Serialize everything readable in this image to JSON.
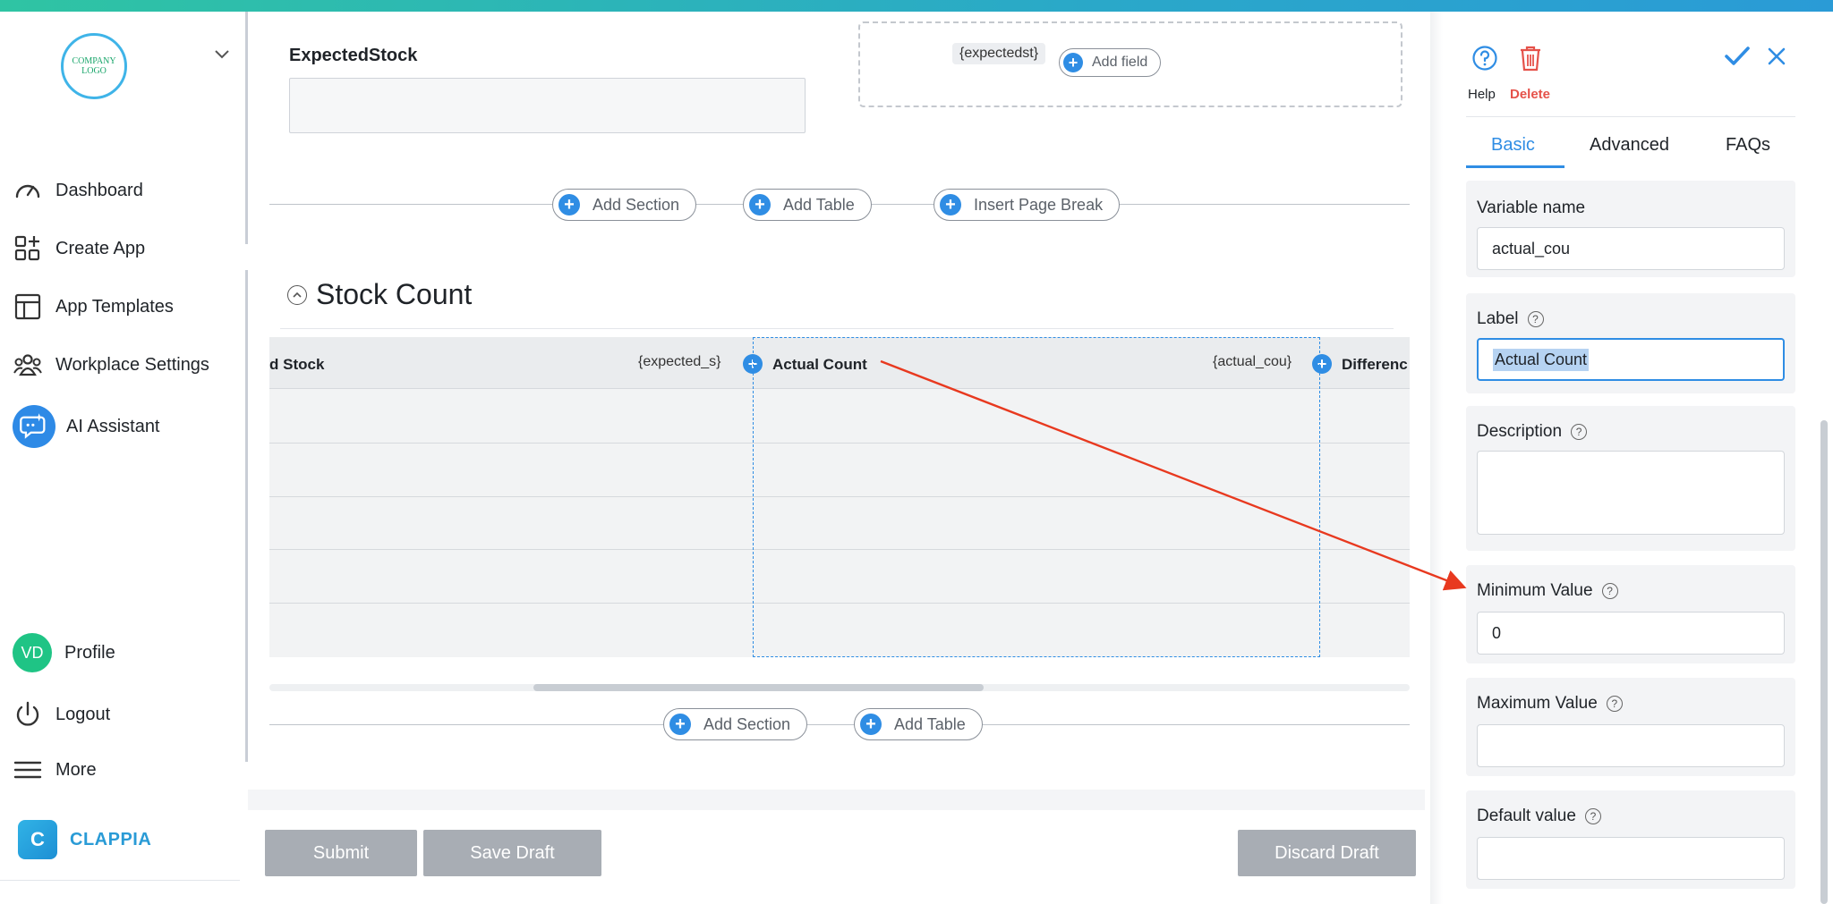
{
  "sidebar": {
    "logo_line1": "COMPANY",
    "logo_line2": "LOGO",
    "nav": [
      {
        "label": "Dashboard",
        "icon": "gauge-icon"
      },
      {
        "label": "Create App",
        "icon": "create-app-icon"
      },
      {
        "label": "App Templates",
        "icon": "templates-icon"
      },
      {
        "label": "Workplace Settings",
        "icon": "people-icon"
      },
      {
        "label": "AI Assistant",
        "icon": "ai-chat-icon"
      }
    ],
    "profile": {
      "initials": "VD",
      "label": "Profile"
    },
    "logout": "Logout",
    "more": "More",
    "brand": "CLAPPIA"
  },
  "form": {
    "expected_field": {
      "label": "ExpectedStock",
      "variable": "{expectedst}"
    },
    "add_field": "Add field",
    "add_section": "Add Section",
    "add_table": "Add Table",
    "insert_page_break": "Insert Page Break",
    "section_title": "Stock Count",
    "table": {
      "columns": [
        {
          "label": "d Stock",
          "variable": "{expected_s}"
        },
        {
          "label": "Actual Count",
          "variable": "{actual_cou}"
        },
        {
          "label": "Differenc",
          "variable": ""
        }
      ],
      "row_count": 5
    },
    "buttons": {
      "submit": "Submit",
      "save_draft": "Save Draft",
      "discard_draft": "Discard Draft"
    }
  },
  "panel": {
    "help": "Help",
    "delete": "Delete",
    "tabs": [
      "Basic",
      "Advanced",
      "FAQs"
    ],
    "active_tab": "Basic",
    "fields": {
      "variable_name": {
        "title": "Variable name",
        "value": "actual_cou"
      },
      "label": {
        "title": "Label",
        "value": "Actual Count"
      },
      "description": {
        "title": "Description",
        "value": ""
      },
      "minimum_value": {
        "title": "Minimum Value",
        "value": "0"
      },
      "maximum_value": {
        "title": "Maximum Value",
        "value": ""
      },
      "default_value": {
        "title": "Default value",
        "value": ""
      }
    }
  },
  "colors": {
    "accent": "#2f8de4",
    "delete": "#e5524a",
    "annotation_arrow": "#e8391f",
    "button_gray": "#a8adb4"
  }
}
